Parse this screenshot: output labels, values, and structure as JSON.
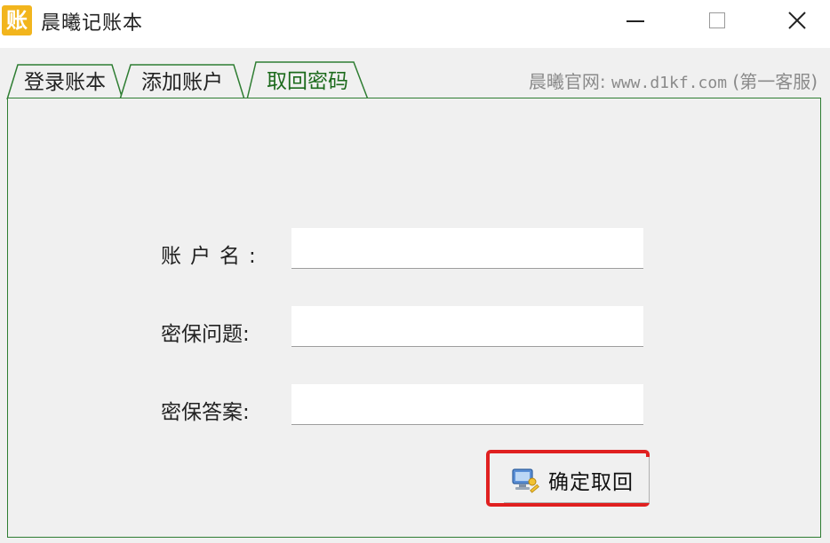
{
  "window": {
    "app_icon_glyph": "账",
    "title": "晨曦记账本",
    "minimize_icon": "minimize-icon",
    "maximize_icon": "maximize-icon",
    "close_icon": "close-icon"
  },
  "tabs": [
    {
      "label": "登录账本",
      "active": false
    },
    {
      "label": "添加账户",
      "active": false
    },
    {
      "label": "取回密码",
      "active": true
    }
  ],
  "website": {
    "prefix": "晨曦官网:",
    "url": "www.d1kf.com",
    "suffix": "(第一客服)"
  },
  "form": {
    "account_label": "账户名:",
    "question_label": "密保问题:",
    "answer_label": "密保答案:",
    "account_value": "",
    "question_value": "",
    "answer_value": ""
  },
  "confirm": {
    "label": "确定取回",
    "icon": "computer-key-icon",
    "highlight_color": "#e02020"
  },
  "colors": {
    "active_tab_text": "#1c6a1c",
    "panel_border": "#2e7d32",
    "app_icon_bg": "#f2b51d"
  }
}
